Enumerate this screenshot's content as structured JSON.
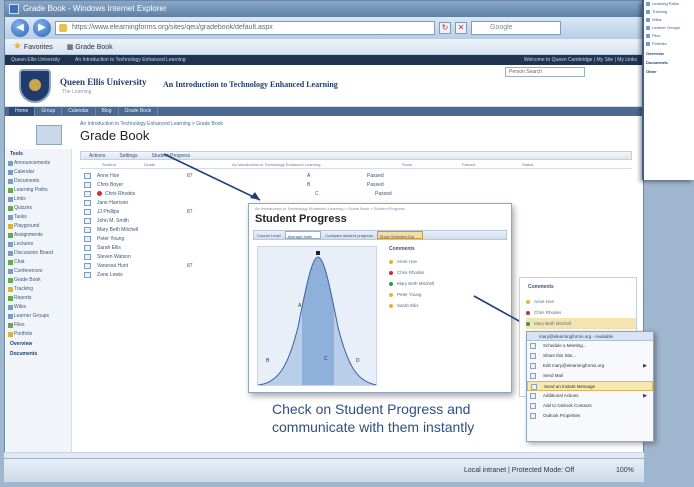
{
  "browser": {
    "title": "Grade Book - Windows Internet Explorer",
    "address": "https://www.elearningforms.org/sites/qeu/gradebook/default.aspx",
    "search_placeholder": "Google",
    "favorites_label": "Favorites",
    "tab_label": "Grade Book",
    "status_zone": "Local intranet | Protected Mode: Off",
    "zoom": "100%"
  },
  "site": {
    "topbar_left": [
      "Queen Ellis University",
      "An Introduction to Technology Enhanced Learning"
    ],
    "topbar_right": "Welcome to Queen Cambridge | My Site | My Links",
    "university": "Queen Ellis University",
    "university_sub": "The Learning",
    "course_title": "An Introduction to Technology Enhanced Learning",
    "people_search": "Person Search",
    "nav": [
      "Home",
      "Group",
      "Calendar",
      "Blog",
      "Grade Book"
    ]
  },
  "quicklaunch": {
    "heading": "Tools",
    "items": [
      "Announcements",
      "Calendar",
      "Documents",
      "Learning Paths",
      "Links",
      "Quizzes",
      "Tasks",
      "Playground",
      "Assignments",
      "Lectures",
      "Discussion Board",
      "Chat",
      "Conferences",
      "Grade Book",
      "Tracking",
      "Reports",
      "Wikis",
      "Learner Groups",
      "Files",
      "Portfolio"
    ],
    "colors": [
      "blue",
      "blue",
      "blue",
      "green",
      "blue",
      "green",
      "blue",
      "yellow",
      "green",
      "blue",
      "blue",
      "green",
      "blue",
      "green",
      "yellow",
      "green",
      "blue",
      "blue",
      "green",
      "yellow"
    ],
    "section2": "Overview",
    "section3": "Documents"
  },
  "page": {
    "breadcrumb": "An Introduction to Technology Enhanced Learning > Grade Book",
    "title": "Grade Book",
    "toolbar": [
      "Actions",
      "Settings",
      "Student Progress"
    ],
    "columns": [
      "Student",
      "Grade",
      "An Introduction to Technology Enhanced Learning",
      "Score",
      "Passed",
      "Status"
    ]
  },
  "gradebook_rows": [
    {
      "name": "Anne Hoe",
      "score": "87",
      "grade": "A",
      "passed": "Passed",
      "flag": false
    },
    {
      "name": "Chris Boyer",
      "score": "",
      "grade": "B",
      "passed": "Passed",
      "flag": false
    },
    {
      "name": "Chris Rhodes",
      "score": "",
      "grade": "C",
      "passed": "Passed",
      "flag": true
    },
    {
      "name": "Jane Harrison",
      "score": "",
      "grade": "",
      "passed": "",
      "flag": false
    },
    {
      "name": "JJ Phillips",
      "score": "87",
      "grade": "",
      "passed": "",
      "flag": false
    },
    {
      "name": "John M. Smith",
      "score": "",
      "grade": "",
      "passed": "",
      "flag": false
    },
    {
      "name": "Mary Beth Mitchell",
      "score": "",
      "grade": "",
      "passed": "",
      "flag": false
    },
    {
      "name": "Peter Young",
      "score": "",
      "grade": "",
      "passed": "",
      "flag": false
    },
    {
      "name": "Sarah Ellis",
      "score": "",
      "grade": "",
      "passed": "",
      "flag": false
    },
    {
      "name": "Steven Watson",
      "score": "",
      "grade": "",
      "passed": "",
      "flag": false
    },
    {
      "name": "Vanessa Hunt",
      "score": "87",
      "grade": "",
      "passed": "",
      "flag": false
    },
    {
      "name": "Zane Lewis",
      "score": "",
      "grade": "",
      "passed": "",
      "flag": false
    }
  ],
  "progress": {
    "breadcrumb": "An Introduction to Technology Enhanced Learning > Grade Book > Student Progress",
    "title": "Student Progress",
    "filter_label": "Course Level",
    "filter_value": "Average Mark",
    "filter_label2": "Compare student progress",
    "filter_value2": "Show Selected Grp",
    "comments_title": "Comments",
    "comments": [
      {
        "name": "Anne Hoe",
        "color": "#e8b33a"
      },
      {
        "name": "Chris Rhodes",
        "color": "#c63030"
      },
      {
        "name": "Mary Beth Mitchell",
        "color": "#2f9a44"
      },
      {
        "name": "Peter Young",
        "color": "#e8b33a"
      },
      {
        "name": "Sarah Ellis",
        "color": "#e8b33a"
      }
    ]
  },
  "comments2": {
    "title": "Comments",
    "items": [
      "Anne Hoe",
      "Chris Rhodes",
      "Mary Beth Mitchell"
    ]
  },
  "context_menu": {
    "header": "mary@elearningforms.org - Available",
    "items": [
      {
        "label": "Schedule a Meeting...",
        "submenu": false,
        "highlight": false
      },
      {
        "label": "Share this Site...",
        "submenu": false,
        "highlight": false
      },
      {
        "label": "Edit mary@elearningforms.org",
        "submenu": true,
        "highlight": false
      },
      {
        "label": "Send Mail",
        "submenu": false,
        "highlight": false
      },
      {
        "label": "Send an Instant Message",
        "submenu": false,
        "highlight": true
      },
      {
        "label": "Additional Actions",
        "submenu": true,
        "highlight": false
      },
      {
        "label": "Add to Outlook Contacts",
        "submenu": false,
        "highlight": false
      },
      {
        "label": "Outlook Properties",
        "submenu": false,
        "highlight": false
      }
    ]
  },
  "caption": "Check on Student Progress and communicate with them instantly",
  "side_window": {
    "items": [
      "Learning Paths",
      "Tracking",
      "Wikis",
      "Learner Groups",
      "Files",
      "Portfolio"
    ],
    "headings": [
      "Overview",
      "Documents",
      "Other"
    ]
  }
}
